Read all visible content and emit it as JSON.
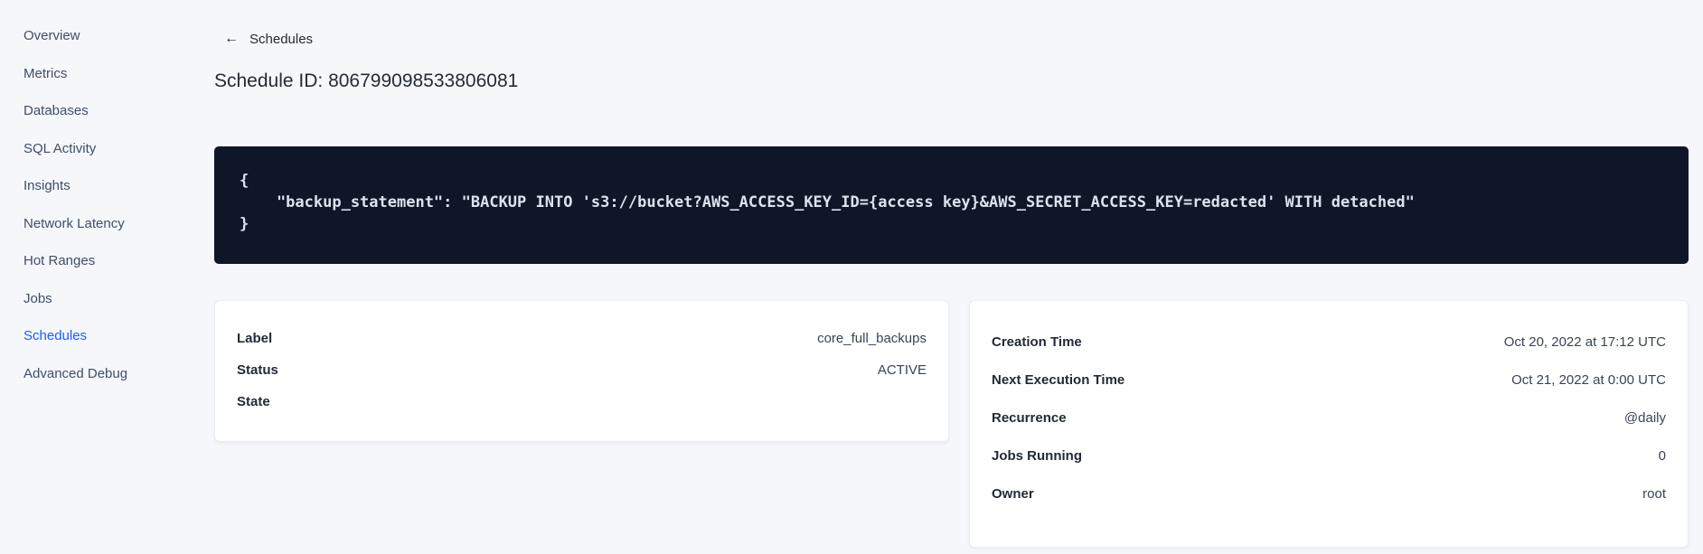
{
  "sidebar": {
    "items": [
      {
        "label": "Overview",
        "active": false
      },
      {
        "label": "Metrics",
        "active": false
      },
      {
        "label": "Databases",
        "active": false
      },
      {
        "label": "SQL Activity",
        "active": false
      },
      {
        "label": "Insights",
        "active": false
      },
      {
        "label": "Network Latency",
        "active": false
      },
      {
        "label": "Hot Ranges",
        "active": false
      },
      {
        "label": "Jobs",
        "active": false
      },
      {
        "label": "Schedules",
        "active": true
      },
      {
        "label": "Advanced Debug",
        "active": false
      }
    ]
  },
  "header": {
    "back_icon": "←",
    "back_label": "Schedules",
    "title": "Schedule ID: 806799098533806081"
  },
  "code_block": {
    "lines": [
      "{",
      "    \"backup_statement\": \"BACKUP INTO 's3://bucket?AWS_ACCESS_KEY_ID={access key}&AWS_SECRET_ACCESS_KEY=redacted' WITH detached\"",
      "}"
    ]
  },
  "details": {
    "left_card": {
      "rows": [
        {
          "label": "Label",
          "value": "core_full_backups"
        },
        {
          "label": "Status",
          "value": "ACTIVE"
        },
        {
          "label": "State",
          "value": ""
        }
      ]
    },
    "right_card": {
      "rows": [
        {
          "label": "Creation Time",
          "value": "Oct 20, 2022 at 17:12 UTC"
        },
        {
          "label": "Next Execution Time",
          "value": "Oct 21, 2022 at 0:00 UTC"
        },
        {
          "label": "Recurrence",
          "value": "@daily"
        },
        {
          "label": "Jobs Running",
          "value": "0"
        },
        {
          "label": "Owner",
          "value": "root"
        }
      ]
    }
  },
  "colors": {
    "active_nav": "#1a5cff",
    "page_background": "#f5f7fa",
    "code_background": "#0f1628",
    "code_text": "#dce3ee",
    "card_background": "#ffffff"
  }
}
